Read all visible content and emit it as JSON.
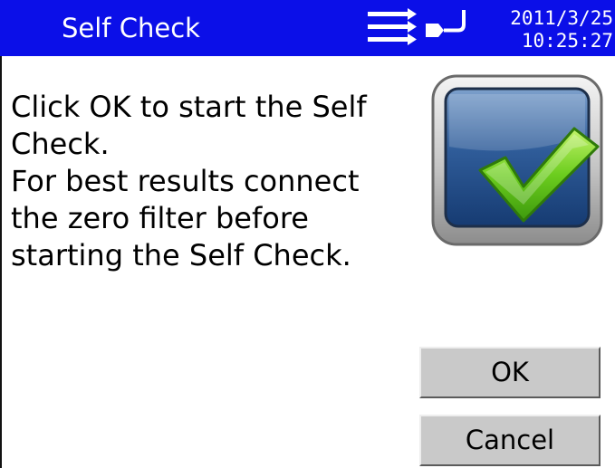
{
  "titlebar": {
    "title": "Self Check",
    "date": "2011/3/25",
    "time": "10:25:27",
    "flow_icon": "flow-arrows-icon",
    "power_icon": "plug-icon",
    "background_color": "#0b0fe8"
  },
  "message": {
    "lines": [
      "Click OK to start the Self",
      "Check.",
      "For best results connect",
      "the zero filter before",
      "starting the Self Check."
    ]
  },
  "graphic": {
    "icon": "monitor-checkmark-icon"
  },
  "buttons": {
    "ok": "OK",
    "cancel": "Cancel"
  }
}
